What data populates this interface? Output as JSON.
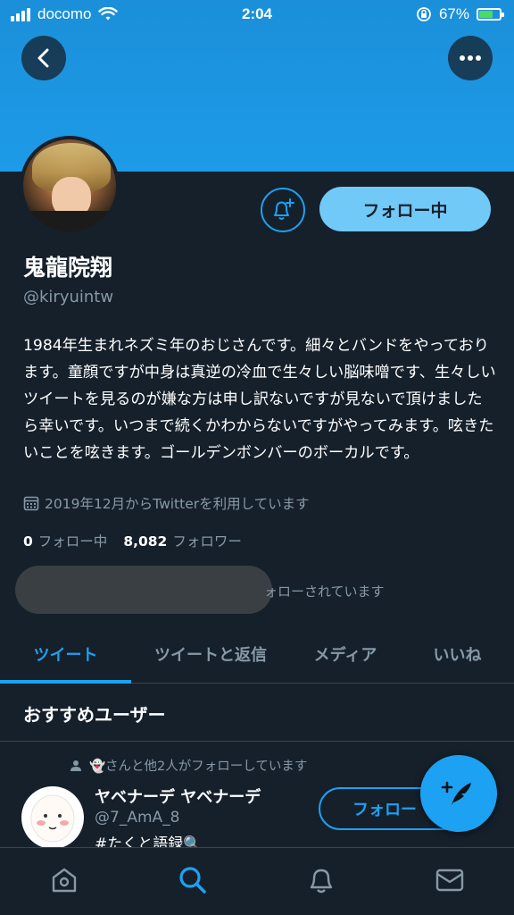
{
  "status_bar": {
    "carrier": "docomo",
    "time": "2:04",
    "battery_percent": "67%",
    "battery_level": 0.67
  },
  "profile": {
    "display_name": "鬼龍院翔",
    "handle": "@kiryuintw",
    "bio": "1984年生まれネズミ年のおじさんです。細々とバンドをやっております。童顔ですが中身は真逆の冷血で生々しい脳味噌です、生々しいツイートを見るのが嫌な方は申し訳ないですが見ないで頂けましたら幸いです。いつまで続くかわからないですがやってみます。呟きたいことを呟きます。ゴールデンボンバーのボーカルです。",
    "joined": "2019年12月からTwitterを利用しています",
    "following_count": "0",
    "following_label": "フォロー中",
    "followers_count": "8,082",
    "followers_label": "フォロワー",
    "followed_by_text": "ォローされています",
    "following_button": "フォロー中"
  },
  "tabs": [
    {
      "label": "ツイート",
      "active": true
    },
    {
      "label": "ツイートと返信",
      "active": false
    },
    {
      "label": "メディア",
      "active": false
    },
    {
      "label": "いいね",
      "active": false
    }
  ],
  "recommendations": {
    "title": "おすすめユーザー",
    "social_context": "👻さんと他2人がフォローしています",
    "user": {
      "name": "ヤベナーデ ヤベナーデ",
      "handle": "@7_AmA_8",
      "bio": "#たくと語録🔍",
      "follow_button": "フォロー"
    }
  },
  "icons": {
    "back": "chevron-left-icon",
    "more": "more-icon",
    "notify": "bell-plus-icon",
    "calendar": "calendar-icon",
    "compose": "compose-tweet-icon",
    "nav": [
      "home-icon",
      "search-icon",
      "notifications-icon",
      "messages-icon"
    ]
  },
  "colors": {
    "accent": "#1da1f2",
    "background": "#15202b",
    "secondary_text": "#8899a6"
  }
}
